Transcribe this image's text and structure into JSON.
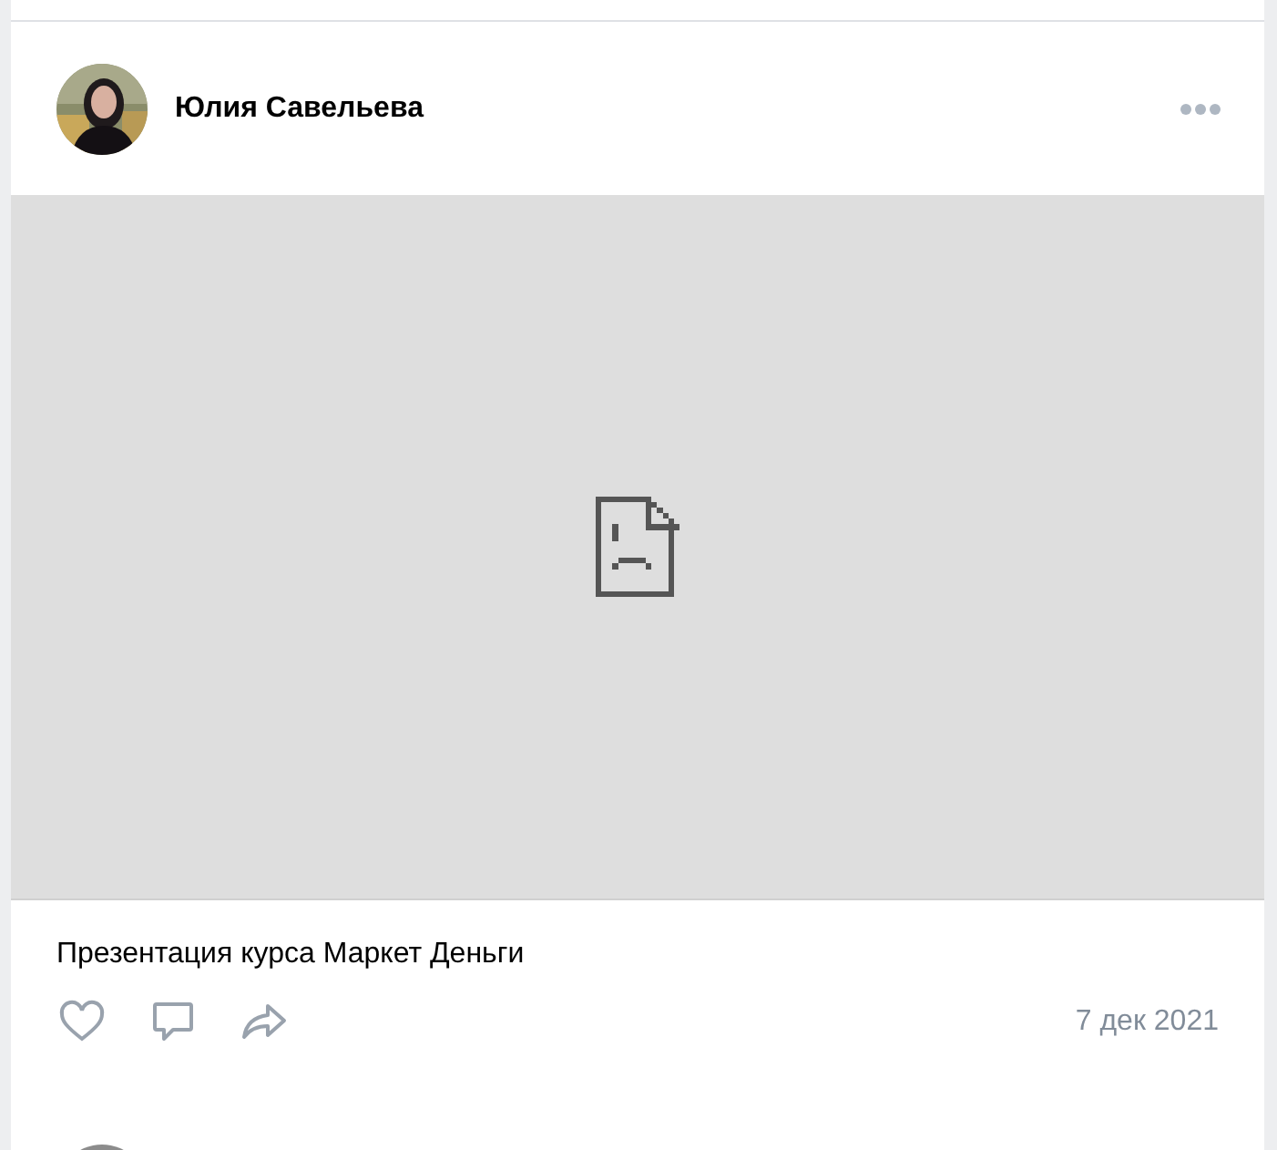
{
  "post": {
    "author": "Юлия Савельева",
    "media": {
      "kind": "broken"
    },
    "caption": "Презентация курса Маркет Деньги",
    "date": "7 дек 2021"
  }
}
